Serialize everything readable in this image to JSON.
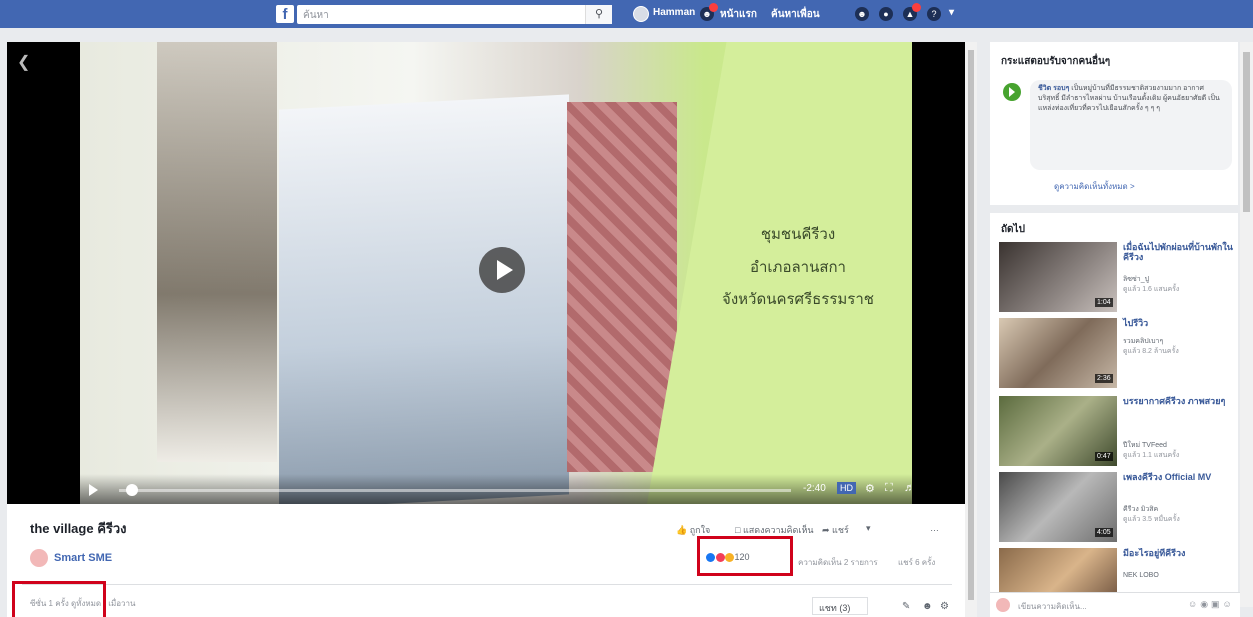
{
  "topbar": {
    "logo": "f",
    "search_placeholder": "ค้นหา",
    "search_button_icon": "search-icon",
    "user_name": "Hamman",
    "nav_home": "หน้าแรก",
    "nav_find_friends": "ค้นหาเพื่อน"
  },
  "video": {
    "overlay_line1": "ชุมชนคีรีวง",
    "overlay_line2": "อำเภอลานสกา",
    "overlay_line3": "จังหวัดนครศรีธรรมราช",
    "time": "-2:40",
    "hd_label": "HD",
    "progress": 0.02
  },
  "post": {
    "title": "the village คีรีวง",
    "page_name": "Smart SME",
    "like_label": "ถูกใจ",
    "comment_label": "แสดงความคิดเห็น",
    "share_label": "แชร์",
    "reaction_count": "120",
    "comments_count": "ความคิดเห็น 2 รายการ",
    "shares_count": "แชร์ 6 ครั้ง",
    "meta": "ซีซั่น 1 ครั้ง  ดูทั้งหมด · เมื่อวาน",
    "sort_label": "แชท (3)"
  },
  "sidebar": {
    "comments_heading": "กระแสตอบรับจากคนอื่นๆ",
    "comment_author": "ชีวิต รอบๆ",
    "comment_text": "เป็นหมู่บ้านที่มีธรรมชาติสวยงามมาก อากาศบริสุทธิ์ มีลำธารไหลผ่าน บ้านเรือนดั้งเดิม ผู้คนอัธยาศัยดี เป็นแหล่งท่องเที่ยวที่ควรไปเยือนสักครั้ง ๆ ๆ ๆ",
    "see_all": "ดูความคิดเห็นทั้งหมด >",
    "next_heading": "ถัดไป",
    "suggestions": [
      {
        "title": "เมื่อฉันไปพักผ่อนที่บ้านพักในคีรีวง",
        "channel": "ลิซซ่า_ปู",
        "views": "ดูแล้ว 1.6 แสนครั้ง",
        "duration": "1:04"
      },
      {
        "title": "ไปรีวิว",
        "channel": "รวมคลิปเบาๆ",
        "views": "ดูแล้ว 8.2 ล้านครั้ง",
        "duration": "2:36"
      },
      {
        "title": "บรรยากาศคีรีวง ภาพสวยๆ",
        "channel": "ปีใหม่ TVFeed",
        "views": "ดูแล้ว 1.1 แสนครั้ง",
        "duration": "0:47"
      },
      {
        "title": "เพลงคีรีวง Official MV",
        "channel": "คีรีวง มิวสิค",
        "views": "ดูแล้ว 3.5 หมื่นครั้ง",
        "duration": "4:05"
      },
      {
        "title": "มีอะไรอยู่ที่คีรีวง",
        "channel": "NEK LOBO",
        "views": "",
        "duration": ""
      }
    ],
    "chat_placeholder": "เขียนความคิดเห็น..."
  },
  "colors": {
    "brand": "#4267b2",
    "highlight_box": "#d0021b"
  }
}
